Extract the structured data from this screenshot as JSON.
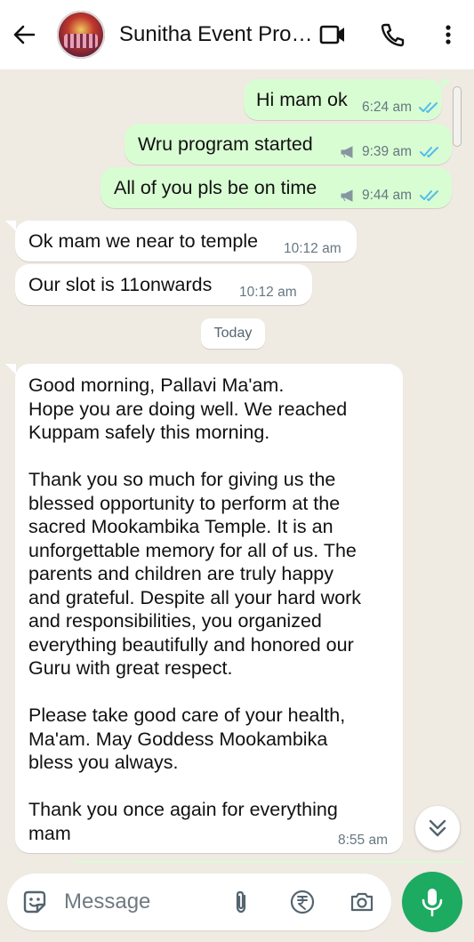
{
  "header": {
    "title": "Sunitha Event Pro…",
    "icons": [
      "back-arrow-icon",
      "video-call-icon",
      "phone-call-icon",
      "more-options-icon"
    ]
  },
  "messages": [
    {
      "id": 1,
      "direction": "outgoing",
      "text": "Hi mam ok",
      "time": "6:24 am",
      "status": "read"
    },
    {
      "id": 2,
      "direction": "outgoing",
      "text": "Wru  program started",
      "time": "9:39 am",
      "status": "read",
      "broadcast": true
    },
    {
      "id": 3,
      "direction": "outgoing",
      "text": "All of you pls be on time",
      "time": "9:44 am",
      "status": "read",
      "broadcast": true
    },
    {
      "id": 4,
      "direction": "incoming",
      "text": "Ok mam we near to temple",
      "time": "10:12 am"
    },
    {
      "id": 5,
      "direction": "incoming",
      "text": "Our slot is 11onwards",
      "time": "10:12 am"
    }
  ],
  "date_separator": "Today",
  "long_message": {
    "direction": "incoming",
    "text": "Good morning, Pallavi Ma'am.\nHope you are doing well. We reached\nKuppam safely this morning.\n\nThank you so much for giving us the\nblessed opportunity to perform at the\nsacred Mookambika Temple. It is an\nunforgettable memory for all of us. The\nparents and children are truly happy\nand grateful. Despite all your hard work\nand responsibilities, you organized\neverything beautifully and honored our\nGuru with great respect.\n\nPlease take good care of your health,\nMa'am. May Goddess Mookambika\nbless you always.\n\nThank you once again for everything\nmam",
    "time": "8:55 am"
  },
  "composer": {
    "placeholder": "Message",
    "icons": [
      "emoji-sticker-icon",
      "attachment-icon",
      "rupee-payment-icon",
      "camera-icon",
      "microphone-icon"
    ]
  },
  "colors": {
    "outgoing_bubble": "#d9fdd3",
    "incoming_bubble": "#ffffff",
    "chat_background": "#efeae2",
    "read_ticks": "#53bdeb",
    "mic_button": "#1daa61"
  }
}
